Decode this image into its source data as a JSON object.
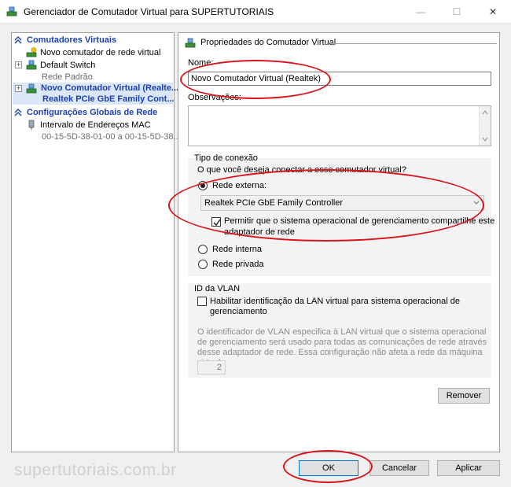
{
  "window": {
    "title": "Gerenciador de Comutador Virtual para SUPERTUTORIAIS",
    "minimize_glyph": "—",
    "maximize_glyph": "☐",
    "close_glyph": "✕"
  },
  "sidebar": {
    "virtual_switches_header": "Comutadores Virtuais",
    "new_switch": "Novo comutador de rede virtual",
    "default_switch": "Default Switch",
    "default_switch_sub": "Rede Padrão",
    "selected_switch": "Novo Comutador Virtual (Realte...",
    "selected_switch_sub": "Realtek PCIe GbE Family Cont...",
    "global_header": "Configurações Globais de Rede",
    "mac_range": "Intervalo de Endereços MAC",
    "mac_range_sub": "00-15-5D-38-01-00 a 00-15-5D-38..."
  },
  "properties": {
    "section_title": "Propriedades do Comutador Virtual",
    "name_label": "Nome:",
    "name_value": "Novo Comutador Virtual (Realtek)",
    "notes_label": "Observações:",
    "notes_value": ""
  },
  "connection": {
    "title": "Tipo de conexão",
    "question": "O que você deseja conectar a esse comutador virtual?",
    "external_label": "Rede externa:",
    "adapter_selected": "Realtek PCIe GbE Family Controller",
    "allow_mgmt_line1": "Permitir que o sistema operacional de gerenciamento compartilhe este",
    "allow_mgmt_line2": "adaptador de rede",
    "internal_label": "Rede interna",
    "private_label": "Rede privada"
  },
  "vlan": {
    "title": "ID da VLAN",
    "enable_line1": "Habilitar identificação da LAN virtual para sistema operacional de",
    "enable_line2": "gerenciamento",
    "description": "O identificador de VLAN especifica à LAN virtual que o sistema operacional de gerenciamento será usado para todas as comunicações de rede através desse adaptador de rede. Essa configuração não afeta a rede da máquina virtual.",
    "id_value": "2"
  },
  "buttons": {
    "remove": "Remover",
    "ok": "OK",
    "cancel": "Cancelar",
    "apply": "Aplicar"
  },
  "watermark": "supertutoriais.com.br",
  "colors": {
    "accent_blue": "#1a3fb0",
    "selection_bg": "#dbe6f7",
    "annotation_red": "#d9141b"
  },
  "icons": {
    "app": "network-switch-icon",
    "switch": "network-switch-icon",
    "mac": "network-adapter-icon"
  }
}
